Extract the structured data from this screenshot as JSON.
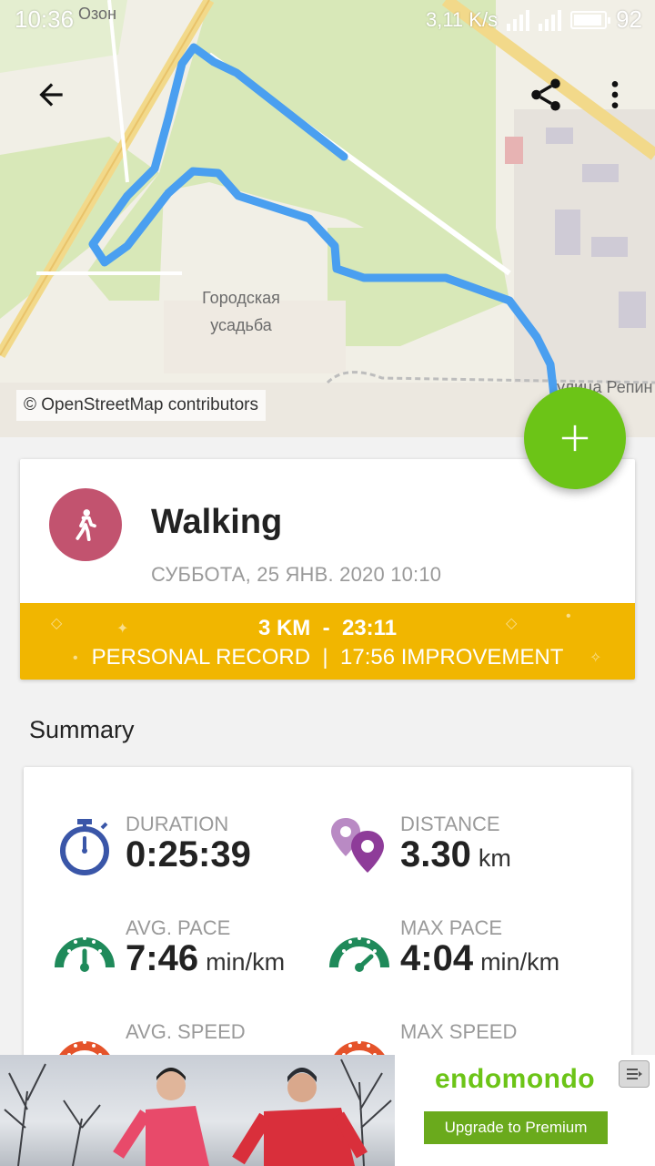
{
  "status_bar": {
    "time": "10:36",
    "network_speed": "3,11 K/s",
    "battery": "92"
  },
  "map": {
    "attribution": "© OpenStreetMap contributors",
    "label_top": "Озон",
    "label_park_line1": "Городская",
    "label_park_line2": "усадьба",
    "label_street": "улица Репин"
  },
  "workout": {
    "sport": "Walking",
    "date": "СУББОТА, 25 ЯНВ. 2020 10:10",
    "record_distance": "3 KM",
    "record_separator": "-",
    "record_time": "23:11",
    "record_note": "PERSONAL RECORD  |  17:56 IMPROVEMENT"
  },
  "summary": {
    "title": "Summary",
    "stats": [
      {
        "label": "DURATION",
        "value": "0:25:39",
        "unit": "",
        "icon": "stopwatch-icon"
      },
      {
        "label": "DISTANCE",
        "value": "3.30",
        "unit": "km",
        "icon": "location-pins-icon"
      },
      {
        "label": "AVG. PACE",
        "value": "7:46",
        "unit": "min/km",
        "icon": "pace-gauge-icon"
      },
      {
        "label": "MAX PACE",
        "value": "4:04",
        "unit": "min/km",
        "icon": "pace-gauge-icon"
      },
      {
        "label": "AVG. SPEED",
        "value": "",
        "unit": "",
        "icon": "speed-gauge-icon"
      },
      {
        "label": "MAX SPEED",
        "value": "",
        "unit": "",
        "icon": "speed-gauge-icon"
      }
    ]
  },
  "ad": {
    "brand": "endomondo",
    "cta": "Upgrade to Premium"
  },
  "colors": {
    "fab": "#6cc417",
    "sport_circle": "#c2536f",
    "record_banner": "#f1b600",
    "route": "#4a9ff0",
    "duration_icon": "#3a56a8",
    "distance_icon": "#8e3c99",
    "pace_icon": "#1f8a5a",
    "speed_icon": "#e5532a"
  }
}
